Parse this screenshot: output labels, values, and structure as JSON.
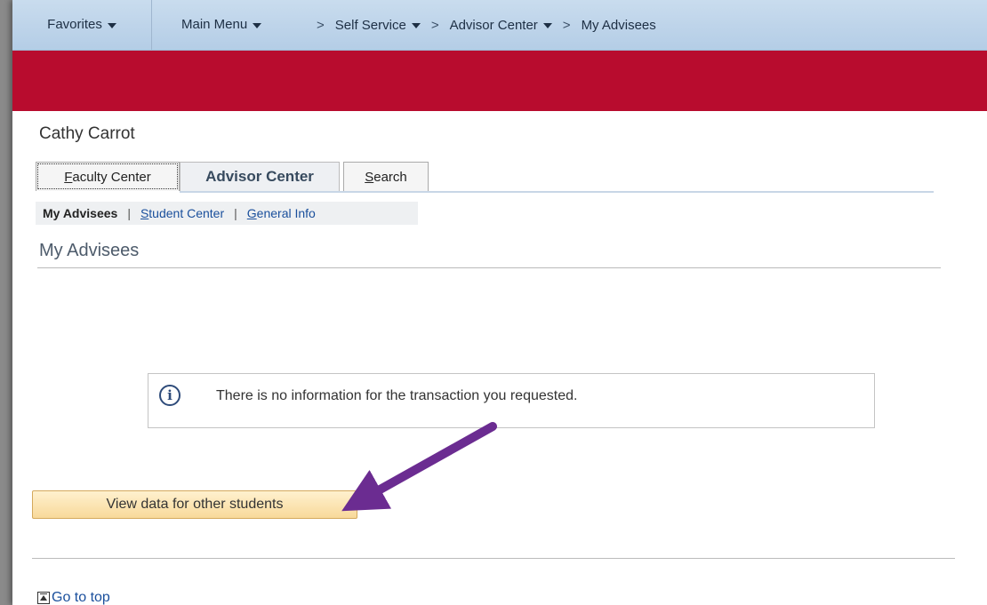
{
  "nav": {
    "favorites": "Favorites",
    "main_menu": "Main Menu",
    "breadcrumbs": [
      "Self Service",
      "Advisor Center",
      "My Advisees"
    ],
    "crumb_separator": ">"
  },
  "header": {
    "user_name": "Cathy Carrot"
  },
  "tabs": {
    "faculty_first": "F",
    "faculty_rest": "aculty Center",
    "advisor": "Advisor Center",
    "search_first": "S",
    "search_rest": "earch"
  },
  "subnav": {
    "current": "My Advisees",
    "separator": "|",
    "student_first": "S",
    "student_rest": "tudent Center",
    "general_first": "G",
    "general_rest": "eneral Info"
  },
  "page": {
    "title": "My Advisees",
    "message": "There is no information for the transaction you requested.",
    "info_icon_glyph": "i",
    "button_label": "View data for other students",
    "go_to_top": "Go to top"
  },
  "colors": {
    "nav_bg": "#b4cde6",
    "brand_red": "#b80c2e",
    "button_bg": "#f8d99a",
    "arrow": "#6b2c91",
    "link": "#1a4f9c"
  }
}
